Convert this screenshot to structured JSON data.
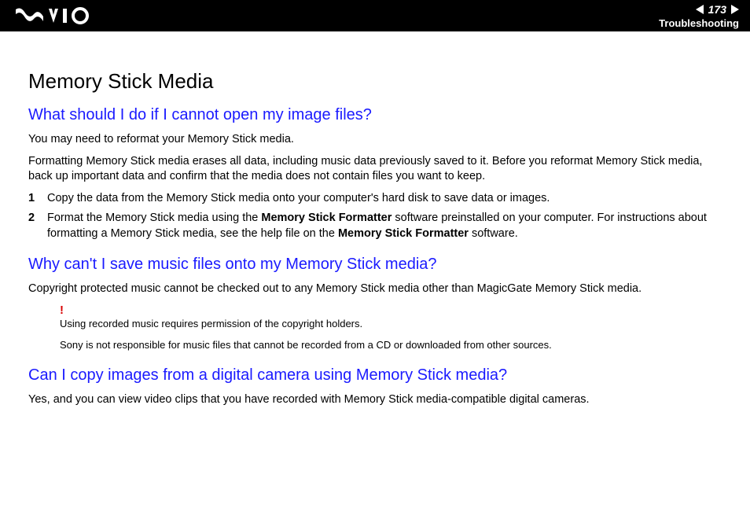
{
  "header": {
    "page_number": "173",
    "section": "Troubleshooting"
  },
  "title": "Memory Stick Media",
  "q1": {
    "heading": "What should I do if I cannot open my image files?",
    "p1": "You may need to reformat your Memory Stick media.",
    "p2": "Formatting Memory Stick media erases all data, including music data previously saved to it. Before you reformat Memory Stick media, back up important data and confirm that the media does not contain files you want to keep.",
    "step1_num": "1",
    "step1": "Copy the data from the Memory Stick media onto your computer's hard disk to save data or images.",
    "step2_num": "2",
    "step2_a": "Format the Memory Stick media using the ",
    "step2_b1": "Memory Stick Formatter",
    "step2_c": " software preinstalled on your computer. For instructions about formatting a Memory Stick media, see the help file on the ",
    "step2_b2": "Memory Stick Formatter",
    "step2_d": " software."
  },
  "q2": {
    "heading": "Why can't I save music files onto my Memory Stick media?",
    "p1": "Copyright protected music cannot be checked out to any Memory Stick media other than MagicGate Memory Stick media.",
    "bang": "!",
    "note1": "Using recorded music requires permission of the copyright holders.",
    "note2": "Sony is not responsible for music files that cannot be recorded from a CD or downloaded from other sources."
  },
  "q3": {
    "heading": "Can I copy images from a digital camera using Memory Stick media?",
    "p1": "Yes, and you can view video clips that you have recorded with Memory Stick media-compatible digital cameras."
  }
}
